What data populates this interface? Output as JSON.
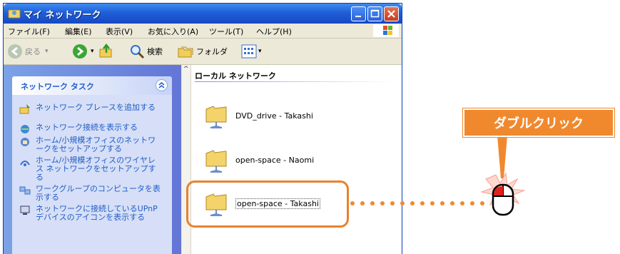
{
  "window": {
    "title": "マイ ネットワーク"
  },
  "menu": [
    "ファイル(F)",
    "編集(E)",
    "表示(V)",
    "お気に入り(A)",
    "ツール(T)",
    "ヘルプ(H)"
  ],
  "toolbar": {
    "back": "戻る",
    "search": "検索",
    "folders": "フォルダ"
  },
  "tasks": {
    "header": "ネットワーク タスク",
    "items": [
      "ネットワーク プレースを追加する",
      "ネットワーク接続を表示する",
      "ホーム/小規模オフィスのネットワークをセットアップする",
      "ホーム/小規模オフィスのワイヤレス ネットワークをセットアップする",
      "ワークグループのコンピュータを表示する",
      "ネットワークに接続しているUPnP デバイスのアイコンを表示する"
    ]
  },
  "content": {
    "group": "ローカル ネットワーク",
    "items": [
      "DVD_drive - Takashi",
      "open-space - Naomi",
      "open-space - Takashi"
    ]
  },
  "annotation": {
    "label": "ダブルクリック",
    "accent": "#f0892e"
  }
}
